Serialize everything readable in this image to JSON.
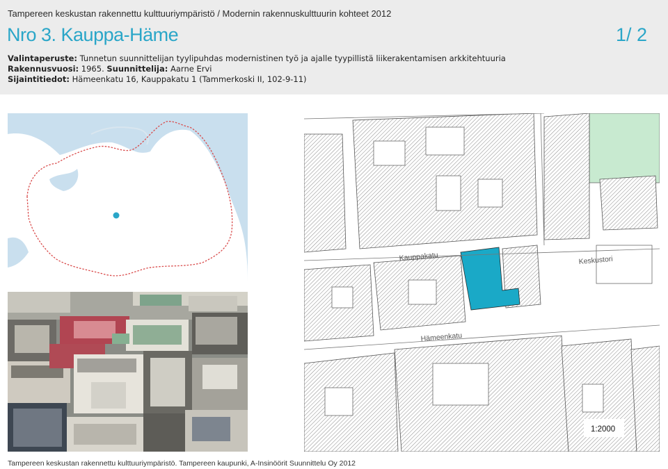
{
  "header": {
    "doc_title": "Tampereen keskustan rakennettu kulttuuriympäristö / Modernin rakennuskulttuurin kohteet 2012",
    "sheet_title": "Nro 3. Kauppa-Häme",
    "page": "1/ 2",
    "criteria_label": "Valintaperuste:",
    "criteria_value": "Tunnetun suunnittelijan tyylipuhdas modernistinen työ ja ajalle tyypillistä liikerakentamisen arkkitehtuuria",
    "year_label": "Rakennusvuosi:",
    "year_value": "1965.",
    "designer_label": "Suunnittelija:",
    "designer_value": "Aarne Ervi",
    "location_label": "Sijaintitiedot:",
    "location_value": "Hämeenkatu 16, Kauppakatu 1 (Tammerkoski II, 102-9-11)"
  },
  "plan_map": {
    "street_1": "Kauppakatu",
    "street_2": "Keskustori",
    "street_3": "Hämeenkatu",
    "scale": "1:2000"
  },
  "colors": {
    "accent": "#2aa6c8",
    "highlight_block": "#1aa9c7",
    "water": "#c9dfee",
    "park": "#c8ead0"
  },
  "footer": {
    "credit": "Tampereen keskustan rakennettu kulttuuriympäristö. Tampereen kaupunki, A-Insinöörit Suunnittelu Oy 2012"
  }
}
